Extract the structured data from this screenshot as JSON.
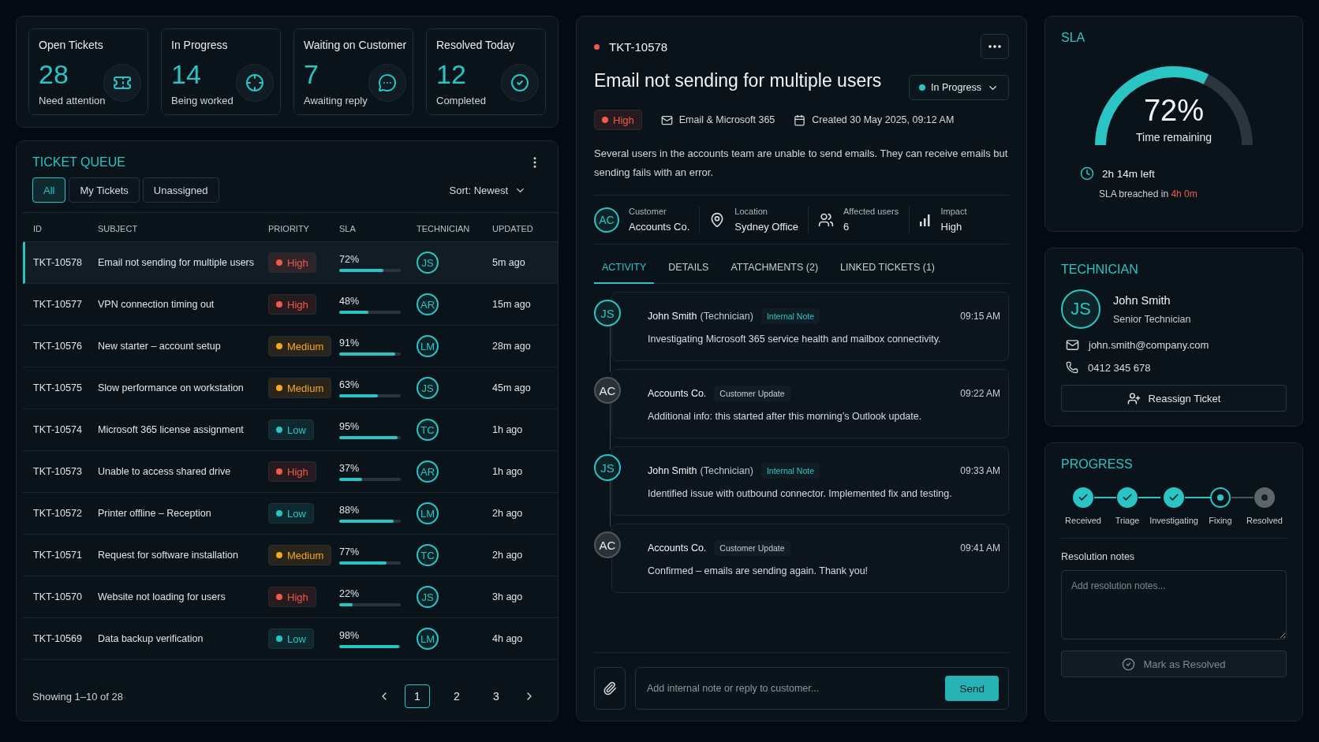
{
  "stats": [
    {
      "kind": "ticket",
      "label": "Open Tickets",
      "value": "28",
      "caption": "Need attention"
    },
    {
      "kind": "target",
      "label": "In Progress",
      "value": "14",
      "caption": "Being worked"
    },
    {
      "kind": "chat",
      "label": "Waiting on Customer",
      "value": "7",
      "caption": "Awaiting reply"
    },
    {
      "kind": "check",
      "label": "Resolved Today",
      "value": "12",
      "caption": "Completed"
    }
  ],
  "queue": {
    "title": "TICKET QUEUE",
    "filters": [
      {
        "label": "All",
        "selected": true
      },
      {
        "label": "My Tickets",
        "selected": false
      },
      {
        "label": "Unassigned",
        "selected": false
      }
    ],
    "sort": "Sort: Newest",
    "columns": [
      "ID",
      "SUBJECT",
      "PRIORITY",
      "SLA",
      "TECHNICIAN",
      "UPDATED"
    ],
    "rows": [
      {
        "id": "TKT-10578",
        "subject": "Email not sending for multiple users",
        "priority": "High",
        "color": "#ef5a4a",
        "sla": "72%",
        "level": 0.72,
        "tech": "JS",
        "updated": "5m ago",
        "selected": true
      },
      {
        "id": "TKT-10577",
        "subject": "VPN connection timing out",
        "priority": "High",
        "color": "#ef5a4a",
        "sla": "48%",
        "level": 0.48,
        "tech": "AR",
        "updated": "15m ago",
        "selected": false
      },
      {
        "id": "TKT-10576",
        "subject": "New starter – account setup",
        "priority": "Medium",
        "color": "#f5a623",
        "sla": "91%",
        "level": 0.91,
        "tech": "LM",
        "updated": "28m ago",
        "selected": false
      },
      {
        "id": "TKT-10575",
        "subject": "Slow performance on workstation",
        "priority": "Medium",
        "color": "#f5a623",
        "sla": "63%",
        "level": 0.63,
        "tech": "JS",
        "updated": "45m ago",
        "selected": false
      },
      {
        "id": "TKT-10574",
        "subject": "Microsoft 365 license assignment",
        "priority": "Low",
        "color": "#2bc4c4",
        "sla": "95%",
        "level": 0.95,
        "tech": "TC",
        "updated": "1h ago",
        "selected": false
      },
      {
        "id": "TKT-10573",
        "subject": "Unable to access shared drive",
        "priority": "High",
        "color": "#ef5a4a",
        "sla": "37%",
        "level": 0.37,
        "tech": "AR",
        "updated": "1h ago",
        "selected": false
      },
      {
        "id": "TKT-10572",
        "subject": "Printer offline – Reception",
        "priority": "Low",
        "color": "#2bc4c4",
        "sla": "88%",
        "level": 0.88,
        "tech": "LM",
        "updated": "2h ago",
        "selected": false
      },
      {
        "id": "TKT-10571",
        "subject": "Request for software installation",
        "priority": "Medium",
        "color": "#f5a623",
        "sla": "77%",
        "level": 0.77,
        "tech": "TC",
        "updated": "2h ago",
        "selected": false
      },
      {
        "id": "TKT-10570",
        "subject": "Website not loading for users",
        "priority": "High",
        "color": "#ef5a4a",
        "sla": "22%",
        "level": 0.22,
        "tech": "JS",
        "updated": "3h ago",
        "selected": false
      },
      {
        "id": "TKT-10569",
        "subject": "Data backup verification",
        "priority": "Low",
        "color": "#2bc4c4",
        "sla": "98%",
        "level": 0.98,
        "tech": "LM",
        "updated": "4h ago",
        "selected": false
      }
    ],
    "footer": "Showing 1–10 of 28",
    "pages": [
      {
        "label": "1",
        "selected": true
      },
      {
        "label": "2",
        "selected": false
      },
      {
        "label": "3",
        "selected": false
      }
    ]
  },
  "ticket": {
    "id": "TKT-10578",
    "title": "Email not sending for multiple users",
    "status": "In Progress",
    "priority": "High",
    "color": "#ef5a4a",
    "category": "Email & Microsoft 365",
    "created": "Created 30 May 2025, 09:12 AM",
    "description": "Several users in the accounts team are unable to send emails. They can receive emails but sending fails with an error.",
    "facts": [
      {
        "kind": "customer",
        "label": "Customer",
        "value": "Accounts Co.",
        "initials": "AC"
      },
      {
        "kind": "location",
        "label": "Location",
        "value": "Sydney Office"
      },
      {
        "kind": "users",
        "label": "Affected users",
        "value": "6"
      },
      {
        "kind": "impact",
        "label": "Impact",
        "value": "High"
      }
    ],
    "tabs": [
      {
        "label": "ACTIVITY",
        "selected": true
      },
      {
        "label": "DETAILS",
        "selected": false
      },
      {
        "label": "ATTACHMENTS (2)",
        "selected": false
      },
      {
        "label": "LINKED TICKETS (1)",
        "selected": false
      }
    ],
    "activity": [
      {
        "kind": "technician",
        "initials": "JS",
        "author": "John Smith",
        "role": "(Technician)",
        "tag": "Internal Note",
        "time": "09:15 AM",
        "text": "Investigating Microsoft 365 service health and mailbox connectivity."
      },
      {
        "kind": "customer",
        "initials": "AC",
        "author": "Accounts Co.",
        "tag": "Customer Update",
        "time": "09:22 AM",
        "text": "Additional info: this started after this morning’s Outlook update."
      },
      {
        "kind": "technician",
        "initials": "JS",
        "author": "John Smith",
        "role": "(Technician)",
        "tag": "Internal Note",
        "time": "09:33 AM",
        "text": "Identified issue with outbound connector. Implemented fix and testing."
      },
      {
        "kind": "customer",
        "initials": "AC",
        "author": "Accounts Co.",
        "tag": "Customer Update",
        "time": "09:41 AM",
        "text": "Confirmed – emails are sending again. Thank you!"
      }
    ],
    "composer": {
      "placeholder": "Add internal note or reply to customer...",
      "send": "Send"
    }
  },
  "sla": {
    "title": "SLA",
    "percent": "72%",
    "caption": "Time remaining",
    "level": 0.72,
    "left": "2h 14m left",
    "breach_text": "SLA breached in",
    "breach_value": "4h 0m"
  },
  "technician": {
    "title": "TECHNICIAN",
    "initials": "JS",
    "name": "John Smith",
    "role": "Senior Technician",
    "email": "john.smith@company.com",
    "phone": "0412 345 678",
    "button": "Reassign Ticket"
  },
  "progress": {
    "title": "PROGRESS",
    "steps": [
      {
        "label": "Received",
        "completed": true,
        "current": false
      },
      {
        "label": "Triage",
        "completed": true,
        "current": false
      },
      {
        "label": "Investigating",
        "completed": true,
        "current": false
      },
      {
        "label": "Fixing",
        "completed": false,
        "current": true
      },
      {
        "label": "Resolved",
        "completed": false,
        "current": false
      }
    ],
    "notes_label": "Resolution notes",
    "notes_placeholder": "Add resolution notes...",
    "button": "Mark as Resolved",
    "button_disabled": true
  }
}
